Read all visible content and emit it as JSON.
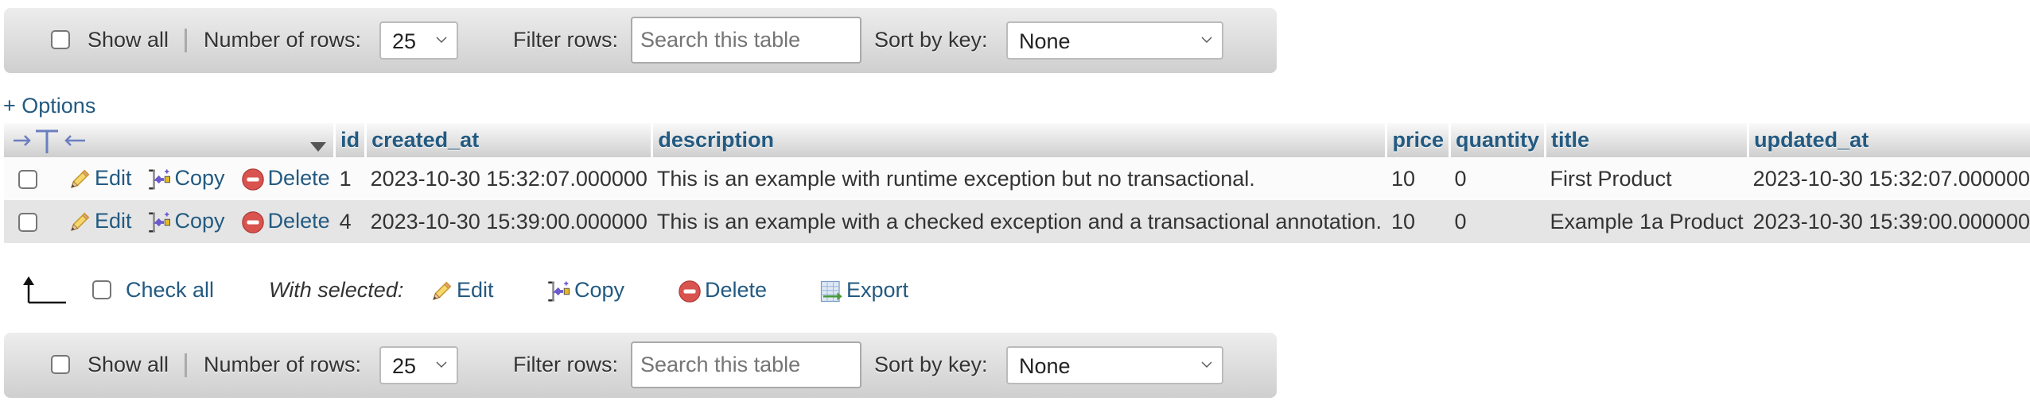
{
  "navigation_top": {
    "show_all_label": "Show all",
    "show_all_checked": false,
    "rows_label": "Number of rows:",
    "rows_value": "25",
    "filter_label": "Filter rows:",
    "filter_placeholder": "Search this table",
    "filter_value": "",
    "sort_label": "Sort by key:",
    "sort_value": "None"
  },
  "options_link": "+ Options",
  "table": {
    "columns": [
      "id",
      "created_at",
      "description",
      "price",
      "quantity",
      "title",
      "updated_at"
    ],
    "row_actions": {
      "edit": "Edit",
      "copy": "Copy",
      "delete": "Delete"
    },
    "rows": [
      {
        "id": "1",
        "created_at": "2023-10-30 15:32:07.000000",
        "description": "This is an example with runtime exception but no transactional.",
        "price": "10",
        "quantity": "0",
        "title": "First Product",
        "updated_at": "2023-10-30 15:32:07.000000"
      },
      {
        "id": "4",
        "created_at": "2023-10-30 15:39:00.000000",
        "description": "This is an example with a checked exception and a transactional annotation.",
        "price": "10",
        "quantity": "0",
        "title": "Example 1a Product",
        "updated_at": "2023-10-30 15:39:00.000000"
      }
    ]
  },
  "bulk_actions": {
    "check_all": "Check all",
    "with_selected": "With selected:",
    "edit": "Edit",
    "copy": "Copy",
    "delete": "Delete",
    "export": "Export"
  },
  "navigation_bottom": {
    "show_all_label": "Show all",
    "show_all_checked": false,
    "rows_label": "Number of rows:",
    "rows_value": "25",
    "filter_label": "Filter rows:",
    "filter_placeholder": "Search this table",
    "filter_value": "",
    "sort_label": "Sort by key:",
    "sort_value": "None"
  },
  "colors": {
    "link": "#235a81",
    "header_gradient_top": "#fafafa",
    "header_gradient_bottom": "#cfcfcf",
    "row_odd": "#fbfbfb",
    "row_even": "#e5e5e5"
  }
}
